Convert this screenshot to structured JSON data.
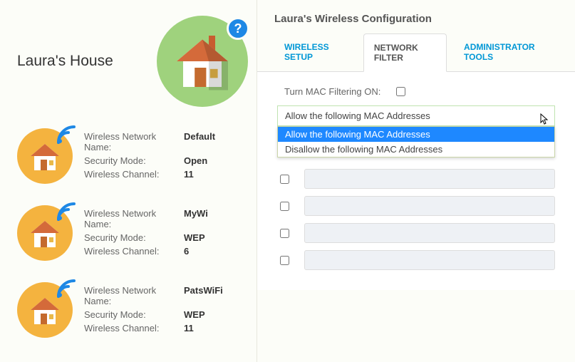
{
  "left": {
    "title": "Laura's House",
    "help_badge": "?",
    "networks": [
      {
        "name_label": "Wireless Network Name:",
        "name": "Default",
        "security_label": "Security Mode:",
        "security": "Open",
        "channel_label": "Wireless Channel:",
        "channel": "11"
      },
      {
        "name_label": "Wireless Network Name:",
        "name": "MyWi",
        "security_label": "Security Mode:",
        "security": "WEP",
        "channel_label": "Wireless Channel:",
        "channel": "6"
      },
      {
        "name_label": "Wireless Network Name:",
        "name": "PatsWiFi",
        "security_label": "Security Mode:",
        "security": "WEP",
        "channel_label": "Wireless Channel:",
        "channel": "11"
      }
    ]
  },
  "right": {
    "panel_title": "Laura's Wireless Configuration",
    "tabs": {
      "wireless_setup": "WIRELESS SETUP",
      "network_filter": "NETWORK FILTER",
      "administrator_tools": "ADMINISTRATOR TOOLS",
      "active": "network_filter"
    },
    "filter": {
      "toggle_label": "Turn MAC Filtering ON:",
      "toggle_checked": false,
      "select_selected": "Allow the following MAC Addresses",
      "options": [
        "Allow the following MAC Addresses",
        "Disallow the following MAC Addresses"
      ],
      "highlighted_option_index": 0,
      "mac_slots": 4
    }
  },
  "colors": {
    "accent_blue": "#0097d6",
    "help_blue": "#1e88e5",
    "green_circle": "#9fd27d",
    "orange_circle": "#f4b33f"
  }
}
